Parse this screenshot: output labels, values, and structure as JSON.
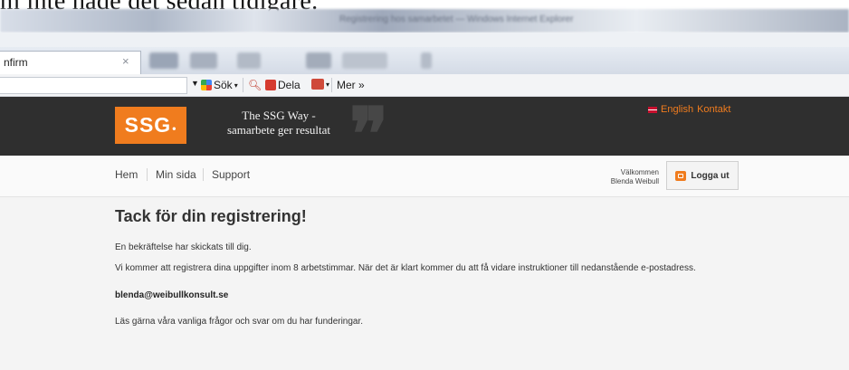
{
  "caption": "m inte hade det sedan tidigare.",
  "window": {
    "title": "Registrering hos samarbetet — Windows Internet Explorer"
  },
  "tab": {
    "title": "nfirm",
    "close_glyph": "×"
  },
  "command_bar": {
    "items": [
      {
        "label": "Sök",
        "icon": "search-engine-icon"
      },
      {
        "label": "",
        "icon": "magnifier-icon"
      },
      {
        "label": "Dela",
        "icon": "share-icon"
      },
      {
        "label": "",
        "icon": "translate-icon"
      },
      {
        "label": "Mer »",
        "icon": ""
      }
    ]
  },
  "header": {
    "logo": "SSG",
    "logo_dot": "•",
    "tagline_line1": "The SSG Way -",
    "tagline_line2": "samarbete ger resultat",
    "quote_glyph": "❞",
    "lang_link": "English",
    "contact_link": "Kontakt",
    "colors": {
      "brand": "#f07c1e",
      "header_bg": "#2f2f2f"
    }
  },
  "nav": {
    "items": [
      "Hem",
      "Min sida",
      "Support"
    ],
    "welcome_line1": "Välkommen",
    "welcome_line2": "Blenda Weibull",
    "logout": "Logga ut"
  },
  "main": {
    "heading": "Tack för din registrering!",
    "paragraph1": "En bekräftelse har skickats till dig.",
    "paragraph2": "Vi kommer att registrera dina uppgifter inom 8 arbetstimmar. När det är klart kommer du att få vidare instruktioner till nedanstående e-postadress.",
    "email": "blenda@weibullkonsult.se",
    "paragraph3": "Läs gärna våra vanliga frågor och svar om du har funderingar."
  }
}
